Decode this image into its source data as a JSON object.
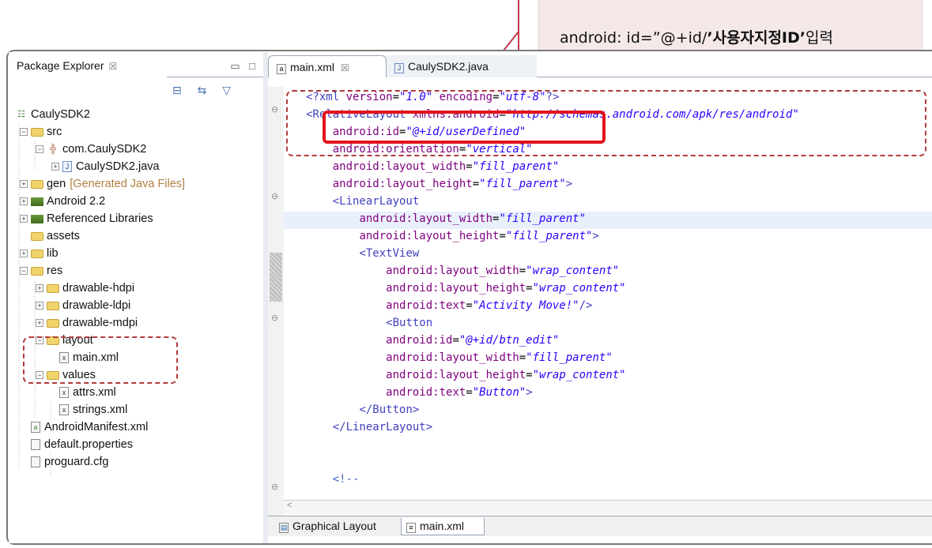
{
  "callout": {
    "prefix": "android: id=”@+id/",
    "bold": "’사용자지정ID’",
    "suffix": "입력"
  },
  "package_explorer": {
    "title": "Package Explorer",
    "close": "☒",
    "window_buttons": "▭ □",
    "toolbar_icons": "⊟ ⇆ ▽",
    "tree": [
      {
        "label": "CaulySDK2",
        "icon": "android-project-icon"
      },
      {
        "label": "src",
        "icon": "source-folder-icon"
      },
      {
        "label": "com.CaulySDK2",
        "icon": "package-icon"
      },
      {
        "label": "CaulySDK2.java",
        "icon": "java-file-icon"
      },
      {
        "label": "gen",
        "extra": "[Generated Java Files]",
        "icon": "source-folder-icon"
      },
      {
        "label": "Android 2.2",
        "icon": "library-icon"
      },
      {
        "label": "Referenced Libraries",
        "icon": "library-icon"
      },
      {
        "label": "assets",
        "icon": "folder-icon"
      },
      {
        "label": "lib",
        "icon": "folder-icon"
      },
      {
        "label": "res",
        "icon": "folder-icon"
      },
      {
        "label": "drawable-hdpi",
        "icon": "folder-icon"
      },
      {
        "label": "drawable-ldpi",
        "icon": "folder-icon"
      },
      {
        "label": "drawable-mdpi",
        "icon": "folder-icon"
      },
      {
        "label": "layout",
        "icon": "folder-icon"
      },
      {
        "label": "main.xml",
        "icon": "xml-file-icon"
      },
      {
        "label": "values",
        "icon": "folder-icon"
      },
      {
        "label": "attrs.xml",
        "icon": "xml-file-icon"
      },
      {
        "label": "strings.xml",
        "icon": "xml-file-icon"
      },
      {
        "label": "AndroidManifest.xml",
        "icon": "android-manifest-icon"
      },
      {
        "label": "default.properties",
        "icon": "text-file-icon"
      },
      {
        "label": "proguard.cfg",
        "icon": "text-file-icon"
      }
    ]
  },
  "editor": {
    "tabs": [
      {
        "label": "main.xml",
        "close": "☒"
      },
      {
        "label": "CaulySDK2.java"
      }
    ],
    "code_lines": [
      "<?xml version=\"1.0\" encoding=\"utf-8\"?>",
      "<RelativeLayout xmlns:android=\"http://schemas.android.com/apk/res/android\"",
      "    android:id=\"@+id/userDefined\"",
      "    android:orientation=\"vertical\"",
      "    android:layout_width=\"fill_parent\"",
      "    android:layout_height=\"fill_parent\">",
      "    <LinearLayout",
      "        android:layout_width=\"fill_parent\"",
      "        android:layout_height=\"fill_parent\">",
      "        <TextView",
      "            android:layout_width=\"wrap_content\"",
      "            android:layout_height=\"wrap_content\"",
      "            android:text=\"Activity Move!\"/>",
      "            <Button",
      "            android:id=\"@+id/btn_edit\"",
      "            android:layout_width=\"fill_parent\"",
      "            android:layout_height=\"wrap_content\"",
      "            android:text=\"Button\">",
      "        </Button>",
      "    </LinearLayout>",
      "",
      "",
      "    <!--"
    ],
    "bottom_tabs": [
      {
        "label": "Graphical Layout"
      },
      {
        "label": "main.xml"
      }
    ]
  },
  "colors": {
    "highlight_red": "#e3131b",
    "dashed_box": "#b03a3a",
    "xml_tag": "#3f3fbf",
    "xml_attr": "#7f007f",
    "xml_value": "#2a00ff"
  }
}
